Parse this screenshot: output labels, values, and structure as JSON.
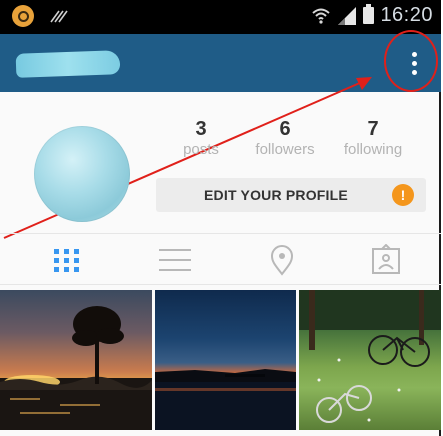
{
  "status_bar": {
    "time": "16:20",
    "icons": [
      "app-notification-icon",
      "nfc-icon",
      "wifi-icon",
      "signal-icon",
      "battery-icon"
    ]
  },
  "app_bar": {
    "background_color": "#1f5c87",
    "menu_icon": "overflow-menu-icon"
  },
  "profile": {
    "stats": [
      {
        "value": "3",
        "label": "posts"
      },
      {
        "value": "6",
        "label": "followers"
      },
      {
        "value": "7",
        "label": "following"
      }
    ],
    "edit_button_label": "EDIT YOUR PROFILE",
    "alert_badge": "!"
  },
  "tabs": [
    {
      "icon": "grid-icon",
      "active": true
    },
    {
      "icon": "list-icon",
      "active": false
    },
    {
      "icon": "location-pin-icon",
      "active": false
    },
    {
      "icon": "tagged-photos-icon",
      "active": false
    }
  ],
  "colors": {
    "accent": "#3897f0",
    "alert": "#f4961c",
    "annotation": "#e0201a"
  }
}
